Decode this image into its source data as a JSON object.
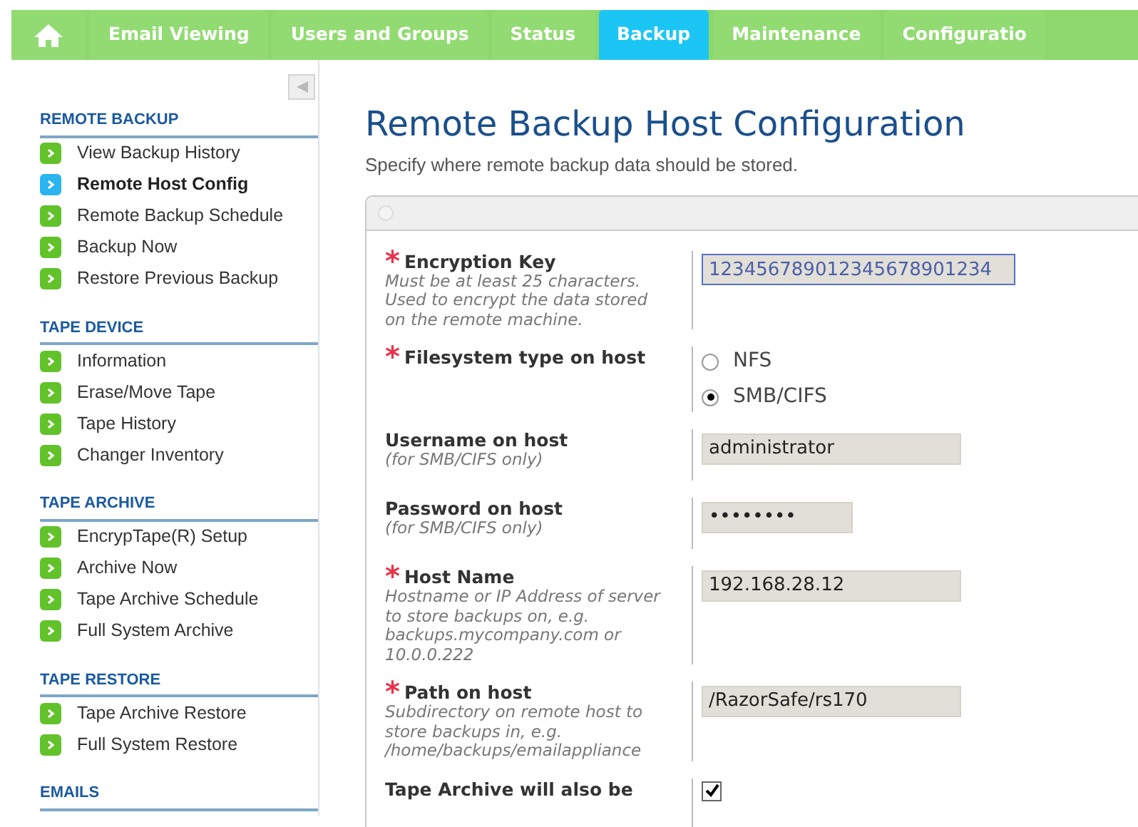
{
  "tabs": [
    {
      "kind": "home",
      "selected": false
    },
    {
      "label": "Email Viewing",
      "selected": false
    },
    {
      "label": "Users and Groups",
      "selected": false
    },
    {
      "label": "Status",
      "selected": false
    },
    {
      "label": "Backup",
      "selected": true
    },
    {
      "label": "Maintenance",
      "selected": false
    },
    {
      "label": "Configuratio",
      "selected": false
    }
  ],
  "sidebar": {
    "sections": [
      {
        "title": "REMOTE BACKUP",
        "items": [
          {
            "label": "View Backup History",
            "selected": false
          },
          {
            "label": "Remote Host Config",
            "selected": true
          },
          {
            "label": "Remote Backup Schedule",
            "selected": false
          },
          {
            "label": "Backup Now",
            "selected": false
          },
          {
            "label": "Restore Previous Backup",
            "selected": false
          }
        ]
      },
      {
        "title": "TAPE DEVICE",
        "items": [
          {
            "label": "Information",
            "selected": false
          },
          {
            "label": "Erase/Move Tape",
            "selected": false
          },
          {
            "label": "Tape History",
            "selected": false
          },
          {
            "label": "Changer Inventory",
            "selected": false
          }
        ]
      },
      {
        "title": "TAPE ARCHIVE",
        "items": [
          {
            "label": "EncrypTape(R) Setup",
            "selected": false
          },
          {
            "label": "Archive Now",
            "selected": false
          },
          {
            "label": "Tape Archive Schedule",
            "selected": false
          },
          {
            "label": "Full System Archive",
            "selected": false
          }
        ]
      },
      {
        "title": "TAPE RESTORE",
        "items": [
          {
            "label": "Tape Archive Restore",
            "selected": false
          },
          {
            "label": "Full System Restore",
            "selected": false
          }
        ]
      },
      {
        "title": "EMAILS"
      }
    ]
  },
  "page": {
    "title": "Remote Backup Host Configuration",
    "subtitle": "Specify where remote backup data should be stored."
  },
  "form": {
    "fields": [
      {
        "kind": "text",
        "label": "Encryption Key",
        "required_mark": "*",
        "hint": "Must be at least 25 characters. Used to encrypt the data stored on the remote machine.",
        "value": "12345678901234567890123​4",
        "focused": true
      },
      {
        "kind": "radio",
        "label": "Filesystem type on host",
        "required_mark": "*",
        "options": [
          {
            "label": "NFS",
            "selected": false
          },
          {
            "label": "SMB/CIFS",
            "selected": true
          }
        ]
      },
      {
        "kind": "text",
        "label": "Username on host",
        "hint": "(for SMB/CIFS only)",
        "value": "administrator",
        "focused": false
      },
      {
        "kind": "password",
        "label": "Password on host",
        "hint": "(for SMB/CIFS only)",
        "value": "••••••••"
      },
      {
        "kind": "text",
        "label": "Host Name",
        "required_mark": "*",
        "hint": "Hostname or IP Address of server to store backups on, e.g. backups.mycompany.com or 10.0.0.222",
        "value": "192.168.28.12",
        "focused": false
      },
      {
        "kind": "text",
        "label": "Path on host",
        "required_mark": "*",
        "hint": "Subdirectory on remote host to store backups in, e.g. /home/backups/emailappliance",
        "value": "/RazorSafe/rs170",
        "focused": false
      },
      {
        "kind": "checkbox",
        "label": "Tape Archive will also be",
        "checked": true
      }
    ]
  }
}
